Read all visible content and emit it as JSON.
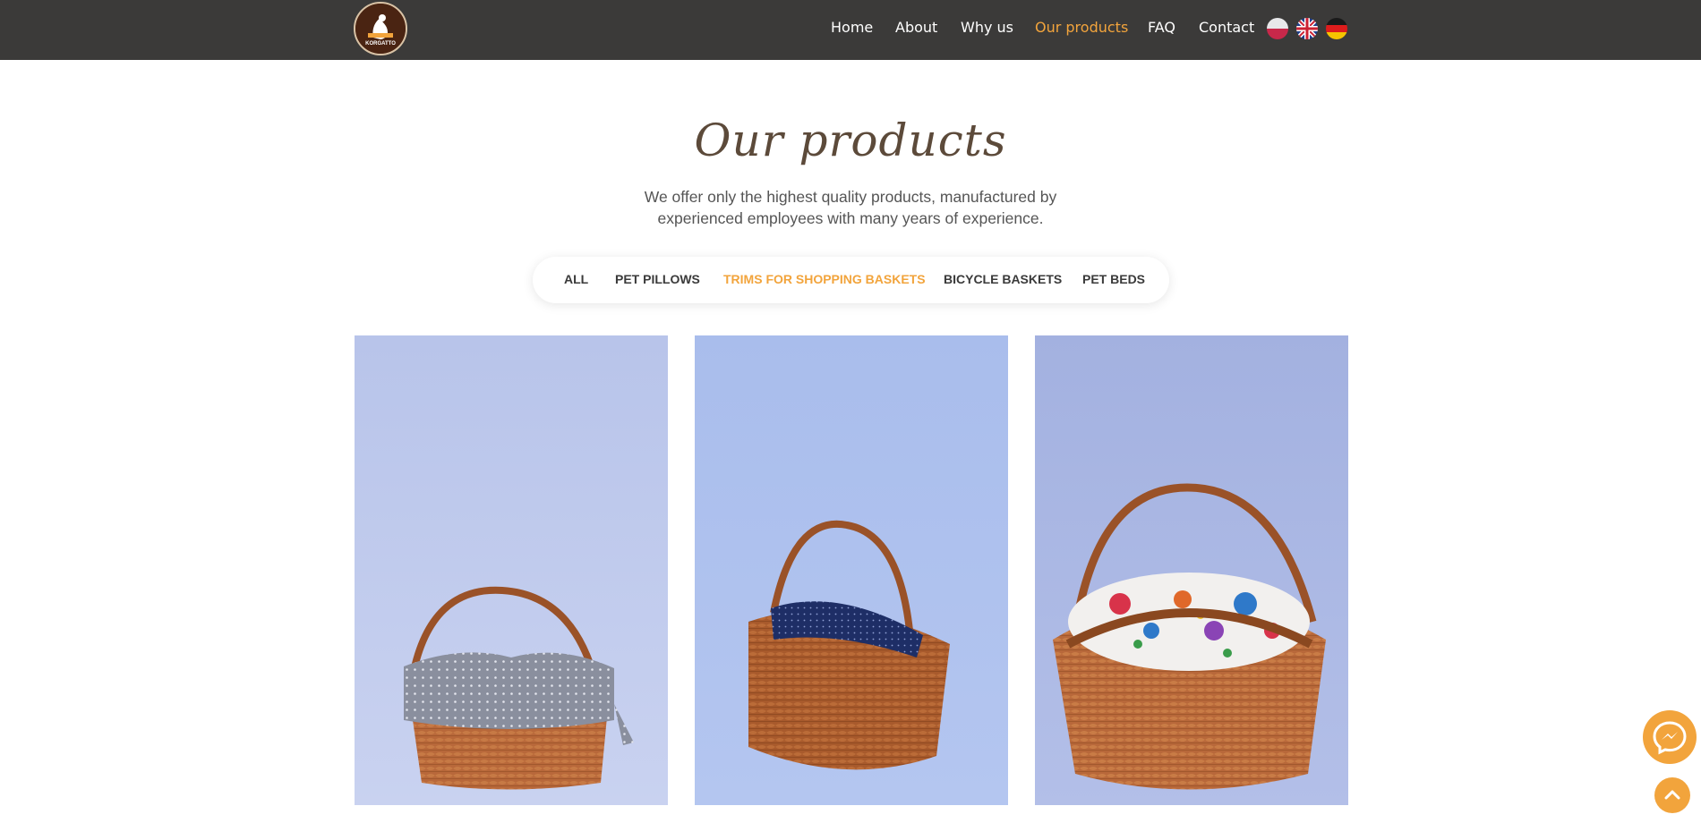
{
  "header": {
    "logo_text": "KORGATTO",
    "nav": [
      {
        "label": "Home"
      },
      {
        "label": "About"
      },
      {
        "label": "Why us"
      },
      {
        "label": "Our products",
        "active": true
      },
      {
        "label": "FAQ"
      },
      {
        "label": "Contact"
      }
    ],
    "languages": [
      "polish-flag-icon",
      "uk-flag-icon",
      "german-flag-icon"
    ]
  },
  "section": {
    "title": "Our products",
    "lead": "We offer only the highest quality products, manufactured by experienced employees with many years of experience."
  },
  "filters": [
    {
      "label": "ALL"
    },
    {
      "label": "PET PILLOWS"
    },
    {
      "label": "TRIMS FOR SHOPPING BASKETS",
      "active": true
    },
    {
      "label": "BICYCLE BASKETS"
    },
    {
      "label": "PET BEDS"
    }
  ],
  "products": [
    {
      "image": "wicker-basket-grey-dotted-liner"
    },
    {
      "image": "wicker-basket-navy-dotted-liner"
    },
    {
      "image": "wicker-basket-floral-liner"
    }
  ],
  "colors": {
    "header_bg": "#3b3a39",
    "accent": "#f2a43c",
    "title": "#5c4a3a",
    "text": "#555555"
  },
  "floating": {
    "messenger_icon": "messenger-icon",
    "back_to_top_icon": "chevron-up-icon"
  }
}
